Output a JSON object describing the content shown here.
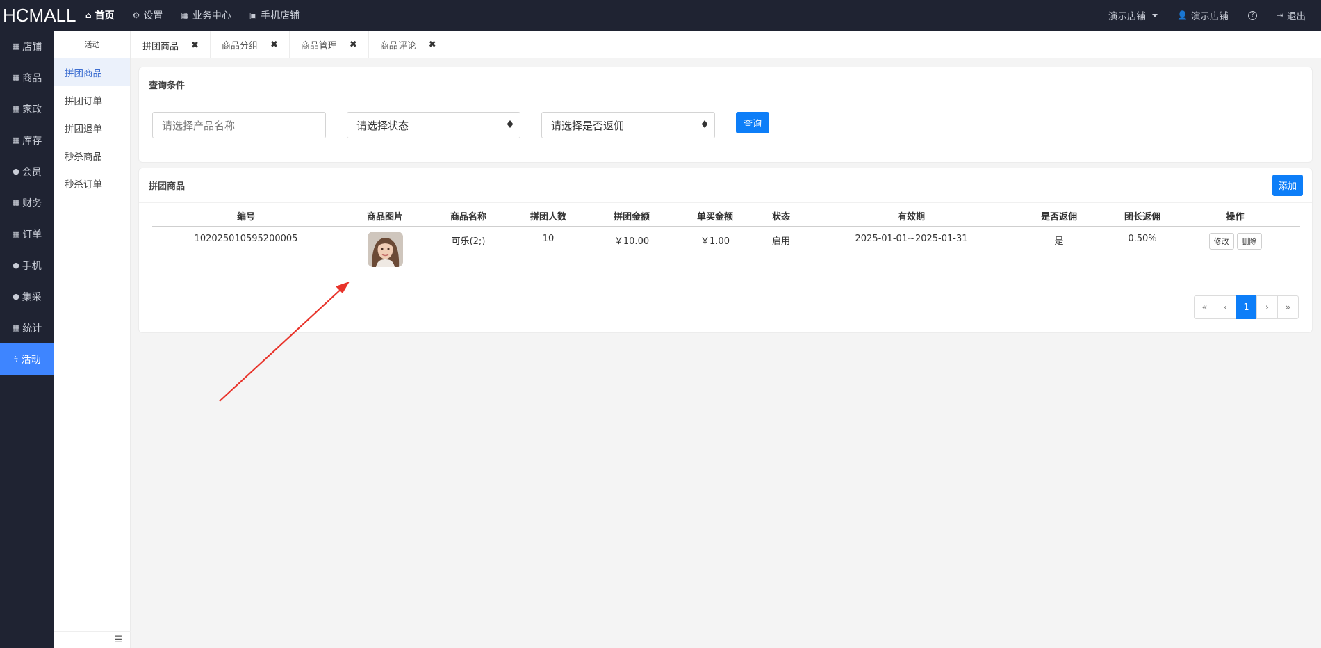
{
  "brand": "HCMALL",
  "topnav": [
    {
      "icon": "⌂",
      "label": "首页"
    },
    {
      "icon": "⚙",
      "label": "设置"
    },
    {
      "icon": "▦",
      "label": "业务中心"
    },
    {
      "icon": "▣",
      "label": "手机店铺"
    }
  ],
  "topright": {
    "store": "演示店铺",
    "user_icon": "👤",
    "user": "演示店铺",
    "help": "?",
    "logout_icon": "⇥",
    "logout": "退出"
  },
  "leftnav": [
    {
      "icon": "▦",
      "label": "店铺"
    },
    {
      "icon": "▦",
      "label": "商品"
    },
    {
      "icon": "▦",
      "label": "家政"
    },
    {
      "icon": "▦",
      "label": "库存"
    },
    {
      "icon": "●",
      "label": "会员"
    },
    {
      "icon": "▦",
      "label": "财务"
    },
    {
      "icon": "▦",
      "label": "订单"
    },
    {
      "icon": "●",
      "label": "手机"
    },
    {
      "icon": "●",
      "label": "集采"
    },
    {
      "icon": "▦",
      "label": "统计"
    },
    {
      "icon": "ϟ",
      "label": "活动"
    }
  ],
  "subnav": {
    "title": "活动",
    "items": [
      "拼团商品",
      "拼团订单",
      "拼团退单",
      "秒杀商品",
      "秒杀订单"
    ],
    "footer_icon": "☰"
  },
  "tabs": [
    {
      "label": "拼团商品",
      "close": "✖"
    },
    {
      "label": "商品分组",
      "close": "✖"
    },
    {
      "label": "商品管理",
      "close": "✖"
    },
    {
      "label": "商品评论",
      "close": "✖"
    }
  ],
  "query": {
    "title": "查询条件",
    "name_placeholder": "请选择产品名称",
    "status_select": "请选择状态",
    "rebate_select": "请选择是否返佣",
    "search_button": "查询"
  },
  "list": {
    "title": "拼团商品",
    "add_button": "添加",
    "columns": [
      "编号",
      "商品图片",
      "商品名称",
      "拼团人数",
      "拼团金额",
      "单买金额",
      "状态",
      "有效期",
      "是否返佣",
      "团长返佣",
      "操作"
    ],
    "rows": [
      {
        "id": "102025010595200005",
        "name": "可乐(2;)",
        "group_size": "10",
        "group_price": "￥10.00",
        "single_price": "￥1.00",
        "status": "启用",
        "validity": "2025-01-01~2025-01-31",
        "rebate": "是",
        "leader_rebate": "0.50%",
        "edit": "修改",
        "delete": "删除"
      }
    ],
    "pager": [
      "«",
      "‹",
      "1",
      "›",
      "»"
    ]
  },
  "colors": {
    "dark": "#1f2332",
    "accent": "#3e85ff",
    "primary": "#0d7ef8",
    "arrow": "#e8332a"
  }
}
